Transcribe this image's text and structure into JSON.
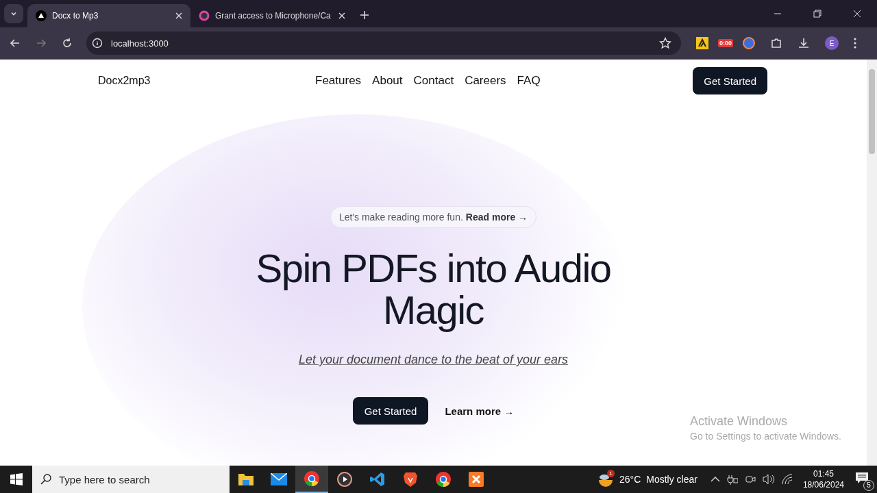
{
  "browser": {
    "tabs": [
      {
        "title": "Docx to Mp3",
        "kind": "triangle",
        "selected": true
      },
      {
        "title": "Grant access to Microphone/Ca",
        "kind": "ring",
        "selected": false
      }
    ],
    "url": "localhost:3000",
    "extension_badge": "0:00",
    "profile": "E"
  },
  "page": {
    "brand": "Docx2mp3",
    "nav": [
      "Features",
      "About",
      "Contact",
      "Careers",
      "FAQ"
    ],
    "header_button": "Get Started",
    "announcement": {
      "text": "Let's make reading more fun.",
      "link": "Read more →"
    },
    "headline": "Spin PDFs into Audio Magic",
    "subtitle": "Let your document dance to the beat of your ears",
    "primary_button": "Get Started",
    "secondary_link": "Learn more →"
  },
  "activation": {
    "title": "Activate Windows",
    "subtitle": "Go to Settings to activate Windows."
  },
  "taskbar": {
    "search_placeholder": "Type here to search",
    "apps": [
      {
        "kind": "folder",
        "selected": false
      },
      {
        "kind": "mail",
        "selected": false
      },
      {
        "kind": "chrome",
        "selected": true
      },
      {
        "kind": "play",
        "selected": false
      },
      {
        "kind": "code",
        "selected": false
      },
      {
        "kind": "lion",
        "selected": false
      },
      {
        "kind": "chrome",
        "selected": false
      },
      {
        "kind": "xampp",
        "selected": false
      }
    ],
    "weather_badge": "1",
    "temperature": "26°C",
    "weather": "Mostly clear",
    "time": "01:45",
    "date": "18/06/2024",
    "notifications": "5"
  }
}
